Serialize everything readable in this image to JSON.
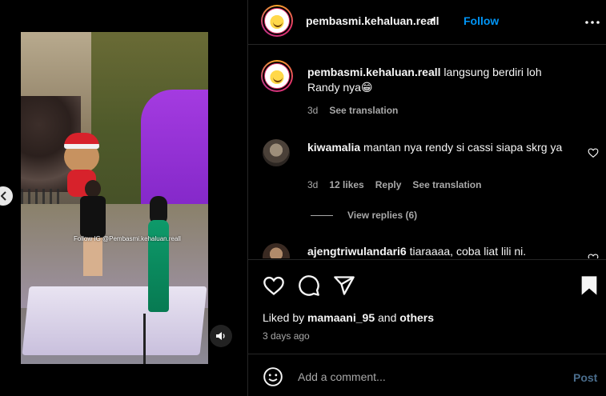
{
  "media": {
    "watermark": "Follow IG @Pembasmi.kehaluan.reall",
    "carousel_dots": 3,
    "active_dot": 2
  },
  "header": {
    "username": "pembasmi.kehaluan.reall",
    "separator": "•",
    "follow_label": "Follow"
  },
  "caption": {
    "username": "pembasmi.kehaluan.reall",
    "text": "langsung berdiri loh Randy nya😁",
    "time": "3d",
    "see_translation": "See translation"
  },
  "comments": [
    {
      "username": "kiwamalia",
      "text": "mantan nya rendy si cassi siapa skrg ya",
      "time": "3d",
      "likes": "12 likes",
      "reply": "Reply",
      "see_translation": "See translation",
      "view_replies": "View replies (6)"
    },
    {
      "username": "ajengtriwulandari6",
      "text": "tiaraaaa, coba liat lili ni."
    }
  ],
  "actions": {
    "liked_by_prefix": "Liked by",
    "liked_by_user": "mamaani_95",
    "liked_by_and": "and",
    "liked_by_others": "others",
    "time_ago": "3 days ago"
  },
  "add_comment": {
    "placeholder": "Add a comment...",
    "post_label": "Post"
  },
  "colors": {
    "accent_blue": "#0095f6",
    "background": "#000000",
    "secondary_text": "#a8a8a8",
    "divider": "#262626"
  }
}
